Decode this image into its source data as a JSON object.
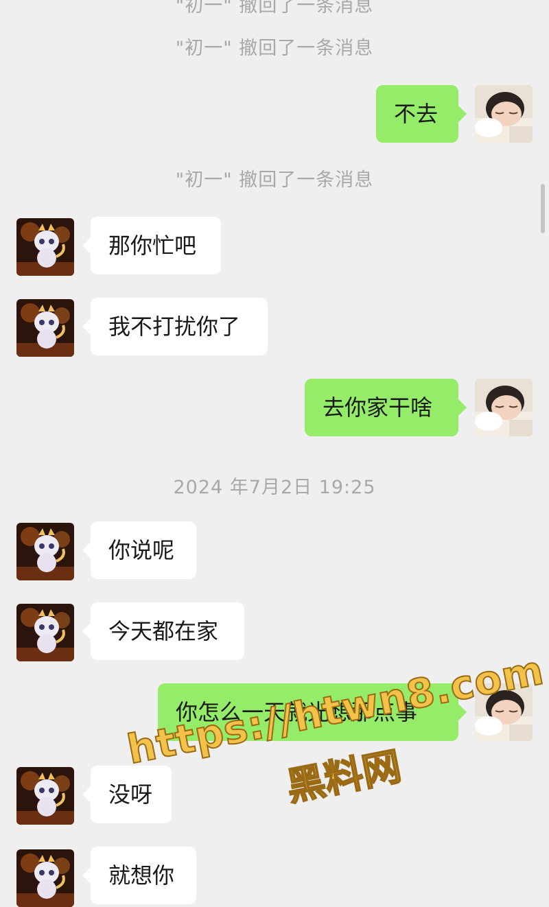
{
  "system_notices": {
    "recall_top_cut": "\"初一\" 撤回了一条消息",
    "recall_1": "\"初一\" 撤回了一条消息",
    "recall_2": "\"初一\" 撤回了一条消息"
  },
  "timestamp": "2024 年7月2日 19:25",
  "messages": [
    {
      "side": "right",
      "text": "不去"
    },
    {
      "side": "left",
      "text": "那你忙吧"
    },
    {
      "side": "left",
      "text": "我不打扰你了"
    },
    {
      "side": "right",
      "text": "去你家干啥"
    },
    {
      "side": "left",
      "text": "你说呢"
    },
    {
      "side": "left",
      "text": "今天都在家"
    },
    {
      "side": "right",
      "text": "你怎么一天就光想那点事"
    },
    {
      "side": "left",
      "text": "没呀"
    },
    {
      "side": "left",
      "text": "就想你"
    }
  ],
  "watermark": {
    "url": "https://htwn8.com",
    "name": "黑料网"
  },
  "avatars": {
    "contact": "dragon-mascot-avatar",
    "self": "sleeping-child-avatar"
  },
  "colors": {
    "background": "#efefef",
    "bubble_self": "#95ec69",
    "bubble_other": "#ffffff",
    "system_text": "#a8a8a8"
  }
}
